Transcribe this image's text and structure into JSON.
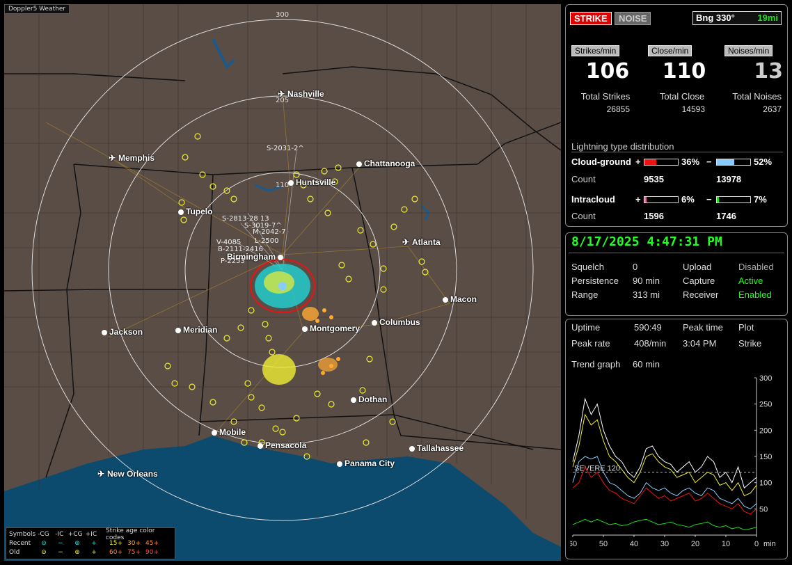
{
  "app": {
    "title": "Doppler5 Weather"
  },
  "map": {
    "range_rings": [
      "300",
      "205",
      "110"
    ],
    "cities": [
      {
        "name": "Nashville",
        "type": "airport"
      },
      {
        "name": "Memphis",
        "type": "airport"
      },
      {
        "name": "Chattanooga",
        "type": "city"
      },
      {
        "name": "Huntsville",
        "type": "city"
      },
      {
        "name": "Tupelo",
        "type": "city"
      },
      {
        "name": "Atlanta",
        "type": "airport"
      },
      {
        "name": "Birmingham",
        "type": "city"
      },
      {
        "name": "Macon",
        "type": "city"
      },
      {
        "name": "Jackson",
        "type": "city"
      },
      {
        "name": "Meridian",
        "type": "city"
      },
      {
        "name": "Montgomery",
        "type": "city"
      },
      {
        "name": "Columbus",
        "type": "city"
      },
      {
        "name": "Dothan",
        "type": "city"
      },
      {
        "name": "Mobile",
        "type": "city"
      },
      {
        "name": "Pensacola",
        "type": "city"
      },
      {
        "name": "Tallahassee",
        "type": "city"
      },
      {
        "name": "Panama City",
        "type": "city"
      },
      {
        "name": "New Orleans",
        "type": "airport"
      }
    ],
    "storm_labels": [
      "S-2031-2^",
      "S-2813-28 13",
      "S-3019-7^",
      "M-2042-7",
      "V-4085",
      "B-2111-2416",
      "L-2500",
      "P-2253"
    ],
    "legend": {
      "symbols_label": "Symbols",
      "headers": [
        "-CG",
        "-IC",
        "+CG",
        "+IC"
      ],
      "age_title": "Strike age color codes",
      "recent_label": "Recent",
      "old_label": "Old",
      "recent_symbols": [
        "⊖",
        "−",
        "⊕",
        "+"
      ],
      "old_symbols": [
        "⊖",
        "−",
        "⊕",
        "+"
      ],
      "recent_ages": [
        "15+",
        "30+",
        "45+"
      ],
      "old_ages": [
        "60+",
        "75+",
        "90+"
      ],
      "recent_colors": [
        "#2dd",
        "#2dd",
        "#2dd",
        "#2dd"
      ],
      "old_colors": [
        "#ee3",
        "#ee3",
        "#ee3",
        "#ee3"
      ],
      "recent_age_colors": [
        "#ee3",
        "#fa3",
        "#f84"
      ],
      "old_age_colors": [
        "#f84",
        "#f64",
        "#f44"
      ]
    }
  },
  "status": {
    "strike_btn": "STRIKE",
    "noise_btn": "NOISE",
    "bearing": "Bng 330°",
    "distance": "19mi",
    "strikes_per_min_label": "Strikes/min",
    "close_per_min_label": "Close/min",
    "noises_per_min_label": "Noises/min",
    "strikes_per_min": "106",
    "close_per_min": "110",
    "noises_per_min": "13",
    "total_strikes_label": "Total Strikes",
    "total_close_label": "Total Close",
    "total_noises_label": "Total Noises",
    "total_strikes": "26855",
    "total_close": "14593",
    "total_noises": "2637",
    "distribution_title": "Lightning type distribution",
    "cg_label": "Cloud-ground",
    "ic_label": "Intracloud",
    "plus": "+",
    "minus": "−",
    "cg_pos_pct": "36%",
    "cg_neg_pct": "52%",
    "ic_pos_pct": "6%",
    "ic_neg_pct": "7%",
    "cg_pos_frac": 0.36,
    "cg_neg_frac": 0.52,
    "ic_pos_frac": 0.06,
    "ic_neg_frac": 0.07,
    "count_label": "Count",
    "cg_pos_count": "9535",
    "cg_neg_count": "13978",
    "ic_pos_count": "1596",
    "ic_neg_count": "1746",
    "colors": {
      "cg_pos": "#e11",
      "cg_neg": "#8cf",
      "ic_pos": "#e6a",
      "ic_neg": "#2d2"
    }
  },
  "settings": {
    "datetime": "8/17/2025 4:47:31 PM",
    "squelch_label": "Squelch",
    "squelch": "0",
    "persistence_label": "Persistence",
    "persistence": "90 min",
    "range_label": "Range",
    "range": "313 mi",
    "upload_label": "Upload",
    "upload": "Disabled",
    "capture_label": "Capture",
    "capture": "Active",
    "receiver_label": "Receiver",
    "receiver": "Enabled"
  },
  "stats": {
    "uptime_label": "Uptime",
    "uptime": "590:49",
    "peak_time_label": "Peak time",
    "peak_time": "3:04 PM",
    "plot_label": "Plot",
    "plot": "Strike",
    "peak_rate_label": "Peak rate",
    "peak_rate": "408/min",
    "trend_label": "Trend graph",
    "trend": "60 min"
  },
  "chart_data": {
    "type": "line",
    "xlabel": "min",
    "x_ticks": [
      "60",
      "50",
      "40",
      "30",
      "20",
      "10",
      "0"
    ],
    "y_ticks": [
      "300",
      "250",
      "200",
      "150",
      "100",
      "50"
    ],
    "ylim": [
      0,
      300
    ],
    "xlim": [
      60,
      0
    ],
    "threshold": {
      "label": "SEVERE 120",
      "value": 120
    },
    "x": [
      60,
      58,
      56,
      54,
      52,
      50,
      48,
      46,
      44,
      42,
      40,
      38,
      36,
      34,
      32,
      30,
      28,
      26,
      24,
      22,
      20,
      18,
      16,
      14,
      12,
      10,
      8,
      6,
      4,
      2,
      0
    ],
    "series": [
      {
        "color": "#fff",
        "values": [
          140,
          190,
          260,
          230,
          250,
          200,
          170,
          150,
          140,
          120,
          110,
          130,
          165,
          170,
          150,
          140,
          135,
          120,
          130,
          140,
          120,
          130,
          150,
          140,
          110,
          120,
          100,
          130,
          90,
          100,
          110
        ]
      },
      {
        "color": "#ee3",
        "values": [
          130,
          170,
          230,
          210,
          220,
          180,
          150,
          140,
          125,
          110,
          100,
          120,
          150,
          155,
          140,
          130,
          125,
          110,
          115,
          120,
          100,
          110,
          120,
          115,
          95,
          100,
          85,
          100,
          75,
          80,
          95
        ]
      },
      {
        "color": "#8cf",
        "values": [
          100,
          140,
          150,
          145,
          150,
          120,
          100,
          95,
          85,
          75,
          70,
          80,
          100,
          90,
          85,
          90,
          80,
          75,
          85,
          90,
          80,
          75,
          90,
          85,
          70,
          65,
          60,
          70,
          55,
          50,
          60
        ]
      },
      {
        "color": "#e11",
        "values": [
          90,
          100,
          130,
          110,
          120,
          100,
          85,
          80,
          70,
          65,
          60,
          75,
          90,
          80,
          70,
          75,
          65,
          70,
          75,
          80,
          65,
          70,
          80,
          70,
          60,
          55,
          50,
          60,
          45,
          40,
          50
        ]
      },
      {
        "color": "#2d2",
        "values": [
          20,
          25,
          30,
          25,
          30,
          25,
          20,
          22,
          18,
          20,
          25,
          28,
          30,
          25,
          20,
          22,
          25,
          20,
          18,
          15,
          20,
          22,
          25,
          18,
          15,
          18,
          12,
          15,
          10,
          12,
          15
        ]
      }
    ]
  }
}
